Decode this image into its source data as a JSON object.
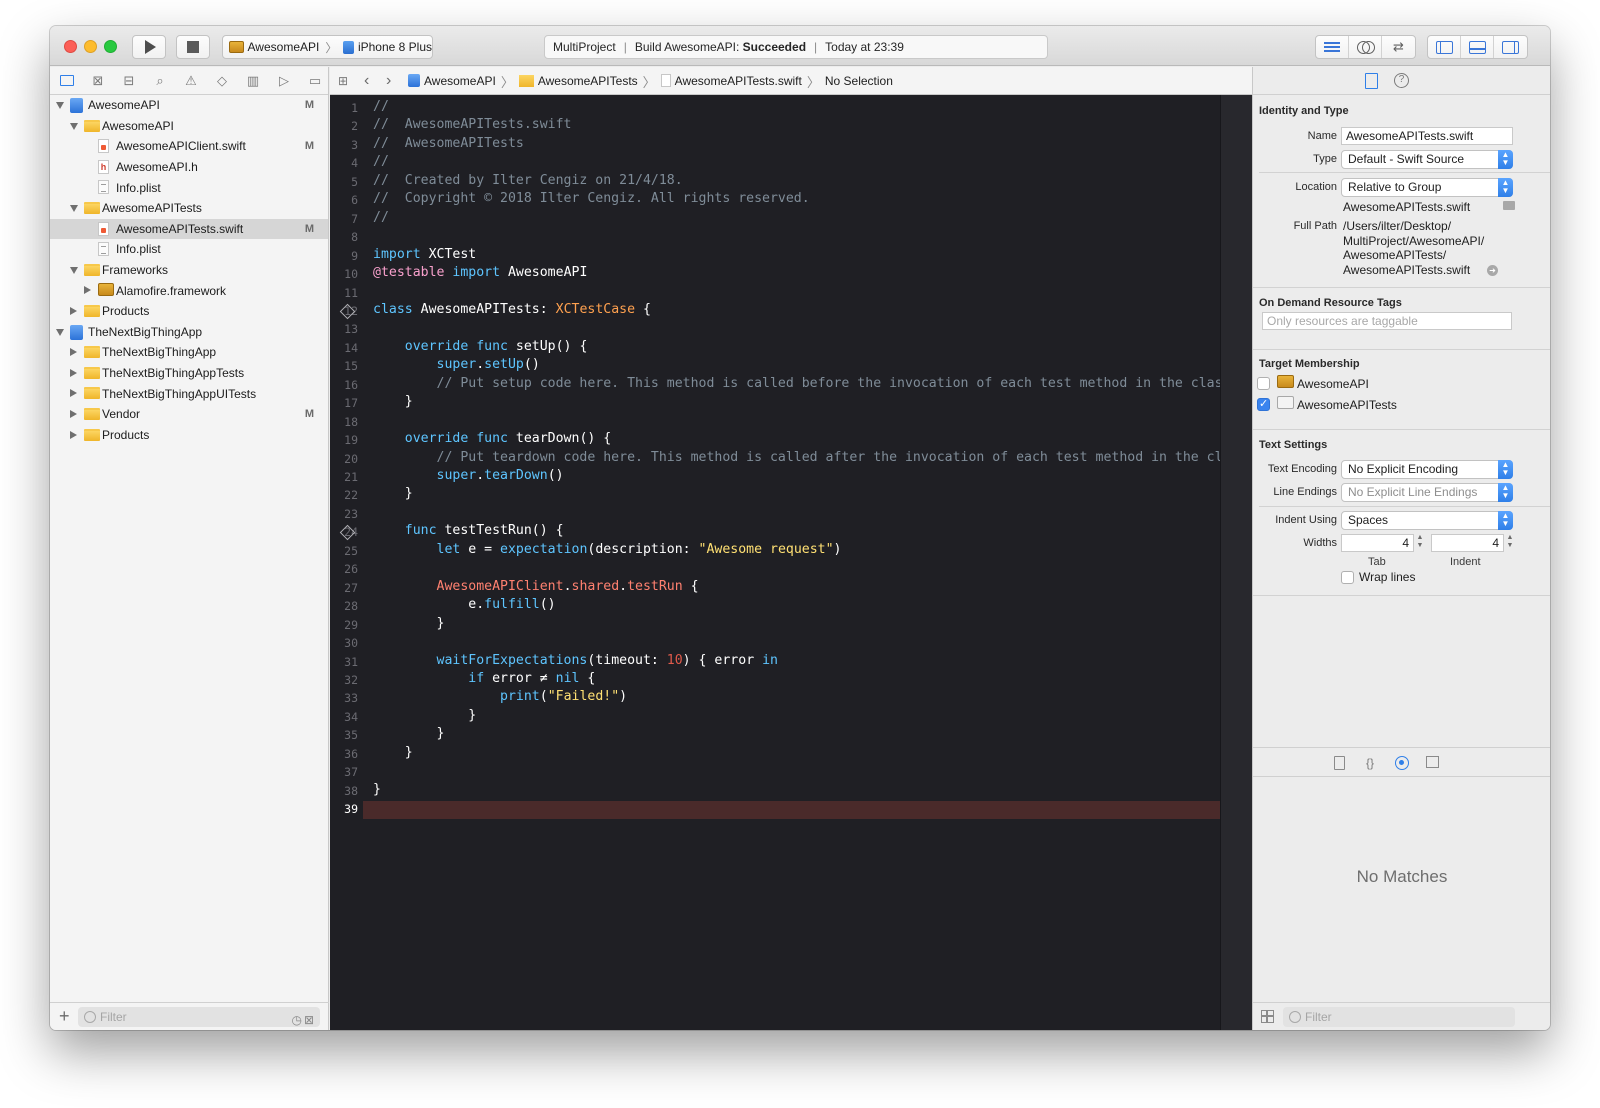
{
  "toolbar": {
    "scheme": "AwesomeAPI",
    "device": "iPhone 8 Plus",
    "activity": {
      "project": "MultiProject",
      "build_prefix": "Build AwesomeAPI: ",
      "build_status": "Succeeded",
      "time": "Today at 23:39"
    }
  },
  "navigator": {
    "tabs": [
      "folder-icon",
      "source-control-icon",
      "hierarchy-icon",
      "search-icon",
      "warning-icon",
      "test-icon",
      "debug-icon",
      "breakpoint-icon",
      "report-icon"
    ],
    "tree": [
      {
        "label": "AwesomeAPI",
        "level": 0,
        "kind": "project",
        "disclosure": "open",
        "badge": "M"
      },
      {
        "label": "AwesomeAPI",
        "level": 1,
        "kind": "folder",
        "disclosure": "open",
        "badge": ""
      },
      {
        "label": "AwesomeAPIClient.swift",
        "level": 2,
        "kind": "swift",
        "disclosure": "",
        "badge": "M"
      },
      {
        "label": "AwesomeAPI.h",
        "level": 2,
        "kind": "h",
        "disclosure": "",
        "badge": ""
      },
      {
        "label": "Info.plist",
        "level": 2,
        "kind": "plist",
        "disclosure": "",
        "badge": ""
      },
      {
        "label": "AwesomeAPITests",
        "level": 1,
        "kind": "folder",
        "disclosure": "open",
        "badge": ""
      },
      {
        "label": "AwesomeAPITests.swift",
        "level": 2,
        "kind": "swift",
        "disclosure": "",
        "badge": "M",
        "selected": true
      },
      {
        "label": "Info.plist",
        "level": 2,
        "kind": "plist",
        "disclosure": "",
        "badge": ""
      },
      {
        "label": "Frameworks",
        "level": 1,
        "kind": "folder",
        "disclosure": "open",
        "badge": ""
      },
      {
        "label": "Alamofire.framework",
        "level": 2,
        "kind": "toolbox",
        "disclosure": "closed",
        "badge": ""
      },
      {
        "label": "Products",
        "level": 1,
        "kind": "folder",
        "disclosure": "closed",
        "badge": ""
      },
      {
        "label": "TheNextBigThingApp",
        "level": 0,
        "kind": "project",
        "disclosure": "open",
        "badge": ""
      },
      {
        "label": "TheNextBigThingApp",
        "level": 1,
        "kind": "folder",
        "disclosure": "closed",
        "badge": ""
      },
      {
        "label": "TheNextBigThingAppTests",
        "level": 1,
        "kind": "folder",
        "disclosure": "closed",
        "badge": ""
      },
      {
        "label": "TheNextBigThingAppUITests",
        "level": 1,
        "kind": "folder",
        "disclosure": "closed",
        "badge": ""
      },
      {
        "label": "Vendor",
        "level": 1,
        "kind": "folder",
        "disclosure": "closed",
        "badge": "M"
      },
      {
        "label": "Products",
        "level": 1,
        "kind": "folder",
        "disclosure": "closed",
        "badge": ""
      }
    ],
    "filter_placeholder": "Filter"
  },
  "jumpbar": {
    "crumbs": [
      "AwesomeAPI",
      "AwesomeAPITests",
      "AwesomeAPITests.swift",
      "No Selection"
    ]
  },
  "editor": {
    "current_line": 39,
    "lines": [
      [
        [
          "//",
          "com"
        ]
      ],
      [
        [
          "//  AwesomeAPITests.swift",
          "com"
        ]
      ],
      [
        [
          "//  AwesomeAPITests",
          "com"
        ]
      ],
      [
        [
          "//",
          "com"
        ]
      ],
      [
        [
          "//  Created by Ilter Cengiz on 21/4/18.",
          "com"
        ]
      ],
      [
        [
          "//  Copyright © 2018 Ilter Cengiz. All rights reserved.",
          "com"
        ]
      ],
      [
        [
          "//",
          "com"
        ]
      ],
      [],
      [
        [
          "import",
          "kw"
        ],
        [
          " XCTest",
          "pln"
        ]
      ],
      [
        [
          "@testable",
          "mac"
        ],
        [
          " import",
          "kw"
        ],
        [
          " AwesomeAPI",
          "pln"
        ]
      ],
      [],
      [
        [
          "class",
          "kw"
        ],
        [
          " AwesomeAPITests: ",
          "pln"
        ],
        [
          "XCTestCase",
          "cls"
        ],
        [
          " {",
          "pln"
        ]
      ],
      [],
      [
        [
          "    override func",
          "kw"
        ],
        [
          " setUp() {",
          "pln"
        ]
      ],
      [
        [
          "        super",
          "kw"
        ],
        [
          ".",
          "pln"
        ],
        [
          "setUp",
          "kw"
        ],
        [
          "()",
          "pln"
        ]
      ],
      [
        [
          "        // Put setup code here. This method is called before the invocation of each test method in the class.",
          "com"
        ]
      ],
      [
        [
          "    }",
          "pln"
        ]
      ],
      [],
      [
        [
          "    override func",
          "kw"
        ],
        [
          " tearDown() {",
          "pln"
        ]
      ],
      [
        [
          "        // Put teardown code here. This method is called after the invocation of each test method in the class.",
          "com"
        ]
      ],
      [
        [
          "        super",
          "kw"
        ],
        [
          ".",
          "pln"
        ],
        [
          "tearDown",
          "kw"
        ],
        [
          "()",
          "pln"
        ]
      ],
      [
        [
          "    }",
          "pln"
        ]
      ],
      [],
      [
        [
          "    func",
          "kw"
        ],
        [
          " testTestRun() {",
          "pln"
        ]
      ],
      [
        [
          "        let",
          "kw"
        ],
        [
          " e = ",
          "pln"
        ],
        [
          "expectation",
          "kw"
        ],
        [
          "(description: ",
          "pln"
        ],
        [
          "\"Awesome request\"",
          "str"
        ],
        [
          ")",
          "pln"
        ]
      ],
      [],
      [
        [
          "        AwesomeAPIClient",
          "type"
        ],
        [
          ".",
          "pln"
        ],
        [
          "shared",
          "type"
        ],
        [
          ".",
          "pln"
        ],
        [
          "testRun",
          "type"
        ],
        [
          " {",
          "pln"
        ]
      ],
      [
        [
          "            e.",
          "pln"
        ],
        [
          "fulfill",
          "kw"
        ],
        [
          "()",
          "pln"
        ]
      ],
      [
        [
          "        }",
          "pln"
        ]
      ],
      [],
      [
        [
          "        waitForExpectations",
          "kw"
        ],
        [
          "(timeout: ",
          "pln"
        ],
        [
          "10",
          "num"
        ],
        [
          ") { error ",
          "pln"
        ],
        [
          "in",
          "kw"
        ]
      ],
      [
        [
          "            if",
          "kw"
        ],
        [
          " error ≠ ",
          "pln"
        ],
        [
          "nil",
          "kw"
        ],
        [
          " {",
          "pln"
        ]
      ],
      [
        [
          "                print",
          "kw"
        ],
        [
          "(",
          "pln"
        ],
        [
          "\"Failed!\"",
          "str"
        ],
        [
          ")",
          "pln"
        ]
      ],
      [
        [
          "            }",
          "pln"
        ]
      ],
      [
        [
          "        }",
          "pln"
        ]
      ],
      [
        [
          "    }",
          "pln"
        ]
      ],
      [],
      [
        [
          "}",
          "pln"
        ]
      ],
      []
    ],
    "test_diamond_lines": [
      12,
      24
    ]
  },
  "inspector": {
    "identity": {
      "title": "Identity and Type",
      "name_label": "Name",
      "name_value": "AwesomeAPITests.swift",
      "type_label": "Type",
      "type_value": "Default - Swift Source",
      "location_label": "Location",
      "location_value": "Relative to Group",
      "location_file": "AwesomeAPITests.swift",
      "full_path_label": "Full Path",
      "full_path_lines": [
        "/Users/ilter/Desktop/",
        "MultiProject/AwesomeAPI/",
        "AwesomeAPITests/",
        "AwesomeAPITests.swift"
      ]
    },
    "on_demand": {
      "title": "On Demand Resource Tags",
      "placeholder": "Only resources are taggable"
    },
    "target_membership": {
      "title": "Target Membership",
      "targets": [
        {
          "label": "AwesomeAPI",
          "checked": false
        },
        {
          "label": "AwesomeAPITests",
          "checked": true
        }
      ]
    },
    "text_settings": {
      "title": "Text Settings",
      "encoding_label": "Text Encoding",
      "encoding_value": "No Explicit Encoding",
      "line_endings_label": "Line Endings",
      "line_endings_value": "No Explicit Line Endings",
      "indent_using_label": "Indent Using",
      "indent_using_value": "Spaces",
      "widths_label": "Widths",
      "tab_width": "4",
      "indent_width": "4",
      "tab_sublabel": "Tab",
      "indent_sublabel": "Indent",
      "wrap_lines_label": "Wrap lines",
      "wrap_lines_checked": false
    },
    "library": {
      "tabs": [
        "file-template-icon",
        "code-snippet-icon",
        "object-library-icon",
        "media-library-icon"
      ],
      "empty_text": "No Matches",
      "filter_placeholder": "Filter"
    }
  },
  "colors": {
    "editor_bg": "#1f1f24",
    "keyword": "#5ec5ff",
    "comment": "#7f8c98",
    "string": "#ffe073",
    "number": "#e05a4b",
    "class_name": "#ffa14f",
    "project_type": "#ff8170",
    "current_line": "#4a2a2a",
    "accent": "#2f7fe8"
  }
}
